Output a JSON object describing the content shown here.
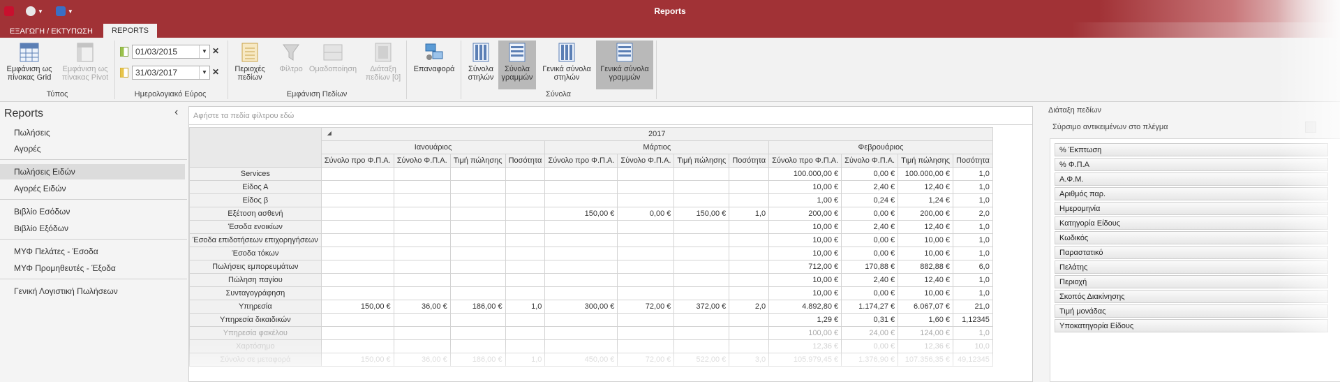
{
  "window": {
    "title": "Reports",
    "colors": {
      "titlebar": "#a13236",
      "accent": "#a13236"
    }
  },
  "ribbon_tabs": [
    {
      "label": "ΕΞΑΓΩΓΗ / ΕΚΤΥΠΩΣΗ",
      "active": false
    },
    {
      "label": "REPORTS",
      "active": true
    }
  ],
  "ribbon": {
    "groups": {
      "type": "Τύπος",
      "date_range": "Ημερολογιακό Εύρος",
      "field_display": "Εμφάνιση Πεδίων",
      "totals": "Σύνολα"
    },
    "buttons": {
      "grid_view": "Εμφάνιση ως πίνακας Grid",
      "pivot_view": "Εμφάνιση ως πίνακας Pivot",
      "field_areas": "Περιοχές πεδίων",
      "filter": "Φίλτρο",
      "grouping": "Ομαδοποίηση",
      "field_layout": "Διάταξη πεδίων [0]",
      "refresh": "Επαναφορά",
      "column_totals": "Σύνολα στηλών",
      "row_totals": "Σύνολα γραμμών",
      "grand_column_totals": "Γενικά σύνολα στηλών",
      "grand_row_totals": "Γενικά σύνολα γραμμών"
    },
    "date_from": "01/03/2015",
    "date_to": "31/03/2017"
  },
  "left_panel": {
    "title": "Reports",
    "items": [
      {
        "label": "Πωλήσεις",
        "selected": false
      },
      {
        "label": "Αγορές",
        "selected": false
      },
      {
        "label": "Πωλήσεις Ειδών",
        "selected": true
      },
      {
        "label": "Αγορές Ειδών",
        "selected": false
      },
      {
        "label": "Βιβλίο Εσόδων",
        "selected": false
      },
      {
        "label": "Βιβλίο Εξόδων",
        "selected": false
      },
      {
        "label": "ΜΥΦ Πελάτες - Έσοδα",
        "selected": false
      },
      {
        "label": "ΜΥΦ Προμηθευτές - Έξοδα",
        "selected": false
      },
      {
        "label": "Γενική Λογιστική Πωλήσεων",
        "selected": false
      }
    ]
  },
  "pivot": {
    "filter_placeholder": "Αφήστε τα πεδία φίλτρου εδώ",
    "year": "2017",
    "months": [
      "Ιανουάριος",
      "Μάρτιος",
      "Φεβρουάριος"
    ],
    "measures": [
      "Σύνολο προ Φ.Π.Α.",
      "Σύνολο Φ.Π.Α.",
      "Τιμή πώλησης",
      "Ποσότητα"
    ],
    "rows": [
      {
        "label": "Services",
        "values": [
          "",
          "",
          "",
          "",
          "",
          "",
          "",
          "",
          "100.000,00 €",
          "0,00 €",
          "100.000,00 €",
          "1,0"
        ]
      },
      {
        "label": "Είδος Α",
        "values": [
          "",
          "",
          "",
          "",
          "",
          "",
          "",
          "",
          "10,00 €",
          "2,40 €",
          "12,40 €",
          "1,0"
        ]
      },
      {
        "label": "Είδος β",
        "values": [
          "",
          "",
          "",
          "",
          "",
          "",
          "",
          "",
          "1,00 €",
          "0,24 €",
          "1,24 €",
          "1,0"
        ]
      },
      {
        "label": "Εξέτοση ασθενή",
        "values": [
          "",
          "",
          "",
          "",
          "150,00 €",
          "0,00 €",
          "150,00 €",
          "1,0",
          "200,00 €",
          "0,00 €",
          "200,00 €",
          "2,0"
        ]
      },
      {
        "label": "Έσοδα ενοικίων",
        "values": [
          "",
          "",
          "",
          "",
          "",
          "",
          "",
          "",
          "10,00 €",
          "2,40 €",
          "12,40 €",
          "1,0"
        ]
      },
      {
        "label": "Έσοδα επιδοτήσεων επιχορηγήσεων",
        "values": [
          "",
          "",
          "",
          "",
          "",
          "",
          "",
          "",
          "10,00 €",
          "0,00 €",
          "10,00 €",
          "1,0"
        ]
      },
      {
        "label": "Έσοδα τόκων",
        "values": [
          "",
          "",
          "",
          "",
          "",
          "",
          "",
          "",
          "10,00 €",
          "0,00 €",
          "10,00 €",
          "1,0"
        ]
      },
      {
        "label": "Πωλήσεις εμπορευμάτων",
        "values": [
          "",
          "",
          "",
          "",
          "",
          "",
          "",
          "",
          "712,00 €",
          "170,88 €",
          "882,88 €",
          "6,0"
        ]
      },
      {
        "label": "Πώληση παγίου",
        "values": [
          "",
          "",
          "",
          "",
          "",
          "",
          "",
          "",
          "10,00 €",
          "2,40 €",
          "12,40 €",
          "1,0"
        ]
      },
      {
        "label": "Συνταγογράφηση",
        "values": [
          "",
          "",
          "",
          "",
          "",
          "",
          "",
          "",
          "10,00 €",
          "0,00 €",
          "10,00 €",
          "1,0"
        ]
      },
      {
        "label": "Υπηρεσία",
        "values": [
          "150,00 €",
          "36,00 €",
          "186,00 €",
          "1,0",
          "300,00 €",
          "72,00 €",
          "372,00 €",
          "2,0",
          "4.892,80 €",
          "1.174,27 €",
          "6.067,07 €",
          "21,0"
        ]
      },
      {
        "label": "Υπηρεσία δικαιδικών",
        "values": [
          "",
          "",
          "",
          "",
          "",
          "",
          "",
          "",
          "1,29 €",
          "0,31 €",
          "1,60 €",
          "1,12345"
        ]
      },
      {
        "label": "Υπηρεσία φακέλου",
        "values": [
          "",
          "",
          "",
          "",
          "",
          "",
          "",
          "",
          "100,00 €",
          "24,00 €",
          "124,00 €",
          "1,0"
        ]
      },
      {
        "label": "Χαρτόσημο",
        "values": [
          "",
          "",
          "",
          "",
          "",
          "",
          "",
          "",
          "12,36 €",
          "0,00 €",
          "12,36 €",
          "10,0"
        ]
      },
      {
        "label": "Σύνολο σε μεταφορά",
        "values": [
          "150,00 €",
          "36,00 €",
          "186,00 €",
          "1,0",
          "450,00 €",
          "72,00 €",
          "522,00 €",
          "3,0",
          "105.979,45 €",
          "1.376,90 €",
          "107.356,35 €",
          "49,12345"
        ]
      }
    ]
  },
  "right_panel": {
    "title": "Διάταξη πεδίων",
    "subtitle": "Σύρσιμο αντικειμένων στο πλέγμα",
    "fields": [
      "% Έκπτωση",
      "% Φ.Π.Α",
      "Α.Φ.Μ.",
      "Αριθμός παρ.",
      "Ημερομηνία",
      "Κατηγορία Είδους",
      "Κωδικός",
      "Παραστατικό",
      "Πελάτης",
      "Περιοχή",
      "Σκοπός Διακίνησης",
      "Τιμή μονάδας",
      "Υποκατηγορία Είδους"
    ]
  }
}
